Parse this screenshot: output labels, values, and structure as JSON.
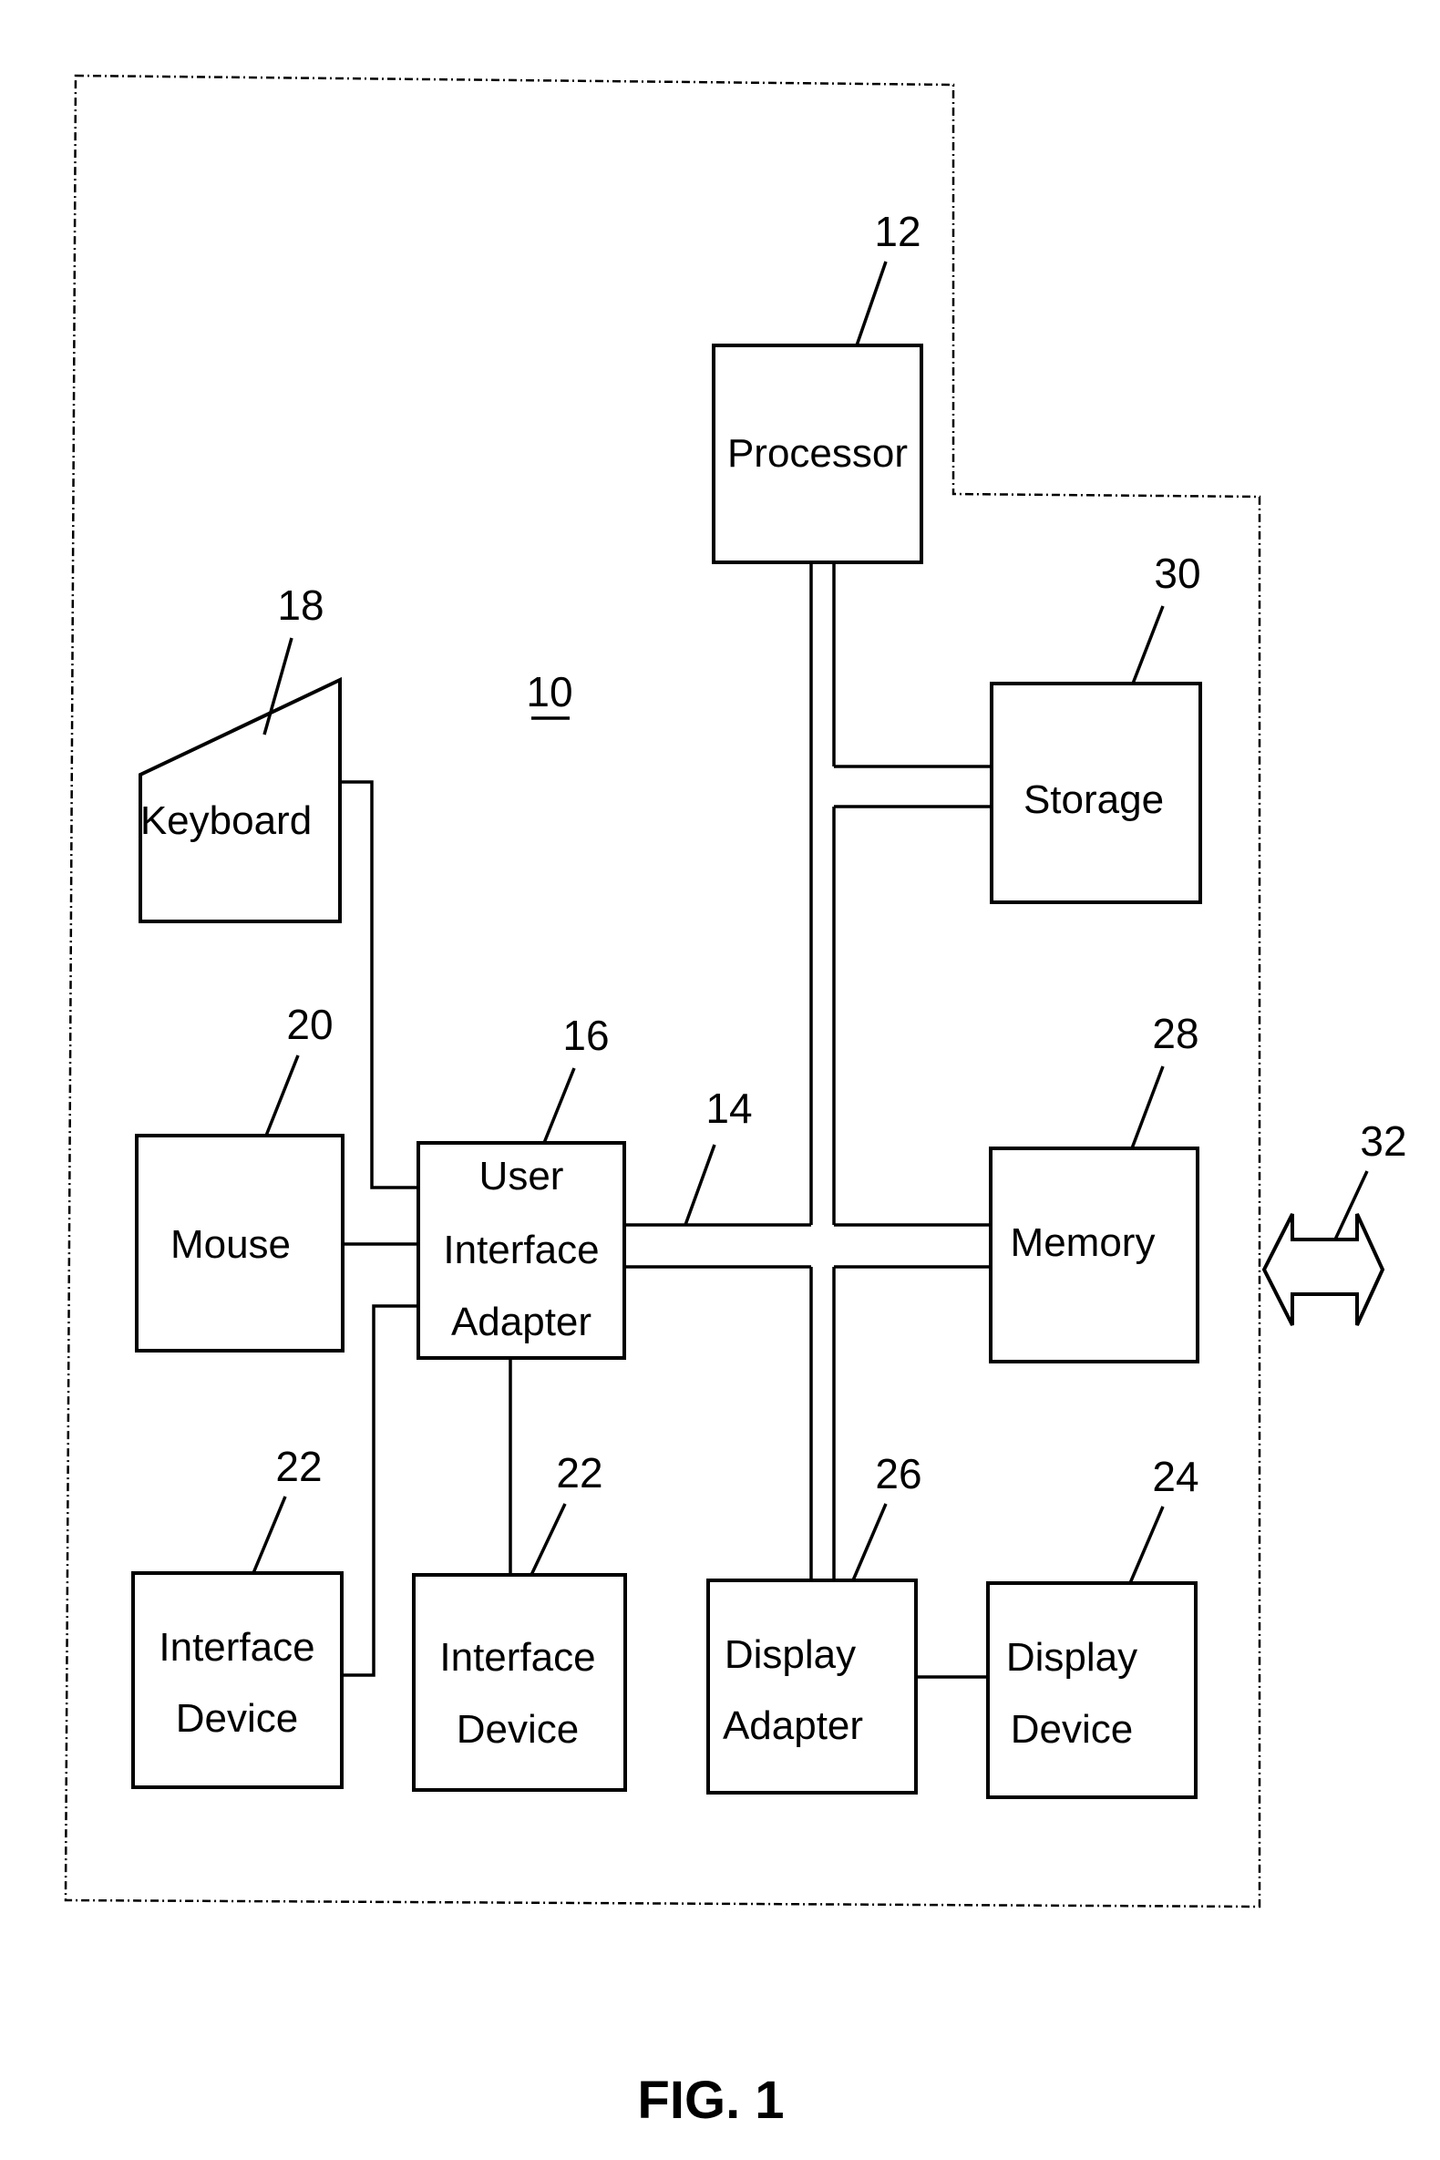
{
  "figure": {
    "caption": "FIG. 1",
    "system_ref": "10",
    "bus_ref": "14",
    "network_ref": "32"
  },
  "blocks": {
    "processor": {
      "ref": "12",
      "lines": [
        "Processor"
      ]
    },
    "storage": {
      "ref": "30",
      "lines": [
        "Storage"
      ]
    },
    "keyboard": {
      "ref": "18",
      "lines": [
        "Keyboard"
      ]
    },
    "mouse": {
      "ref": "20",
      "lines": [
        "Mouse"
      ]
    },
    "user_interface_adapter": {
      "ref": "16",
      "lines": [
        "User",
        "Interface",
        "Adapter"
      ]
    },
    "memory": {
      "ref": "28",
      "lines": [
        "Memory"
      ]
    },
    "interface_device_1": {
      "ref": "22",
      "lines": [
        "Interface",
        "Device"
      ]
    },
    "interface_device_2": {
      "ref": "22",
      "lines": [
        "Interface",
        "Device"
      ]
    },
    "display_adapter": {
      "ref": "26",
      "lines": [
        "Display",
        "Adapter"
      ]
    },
    "display_device": {
      "ref": "24",
      "lines": [
        "Display",
        "Device"
      ]
    }
  }
}
